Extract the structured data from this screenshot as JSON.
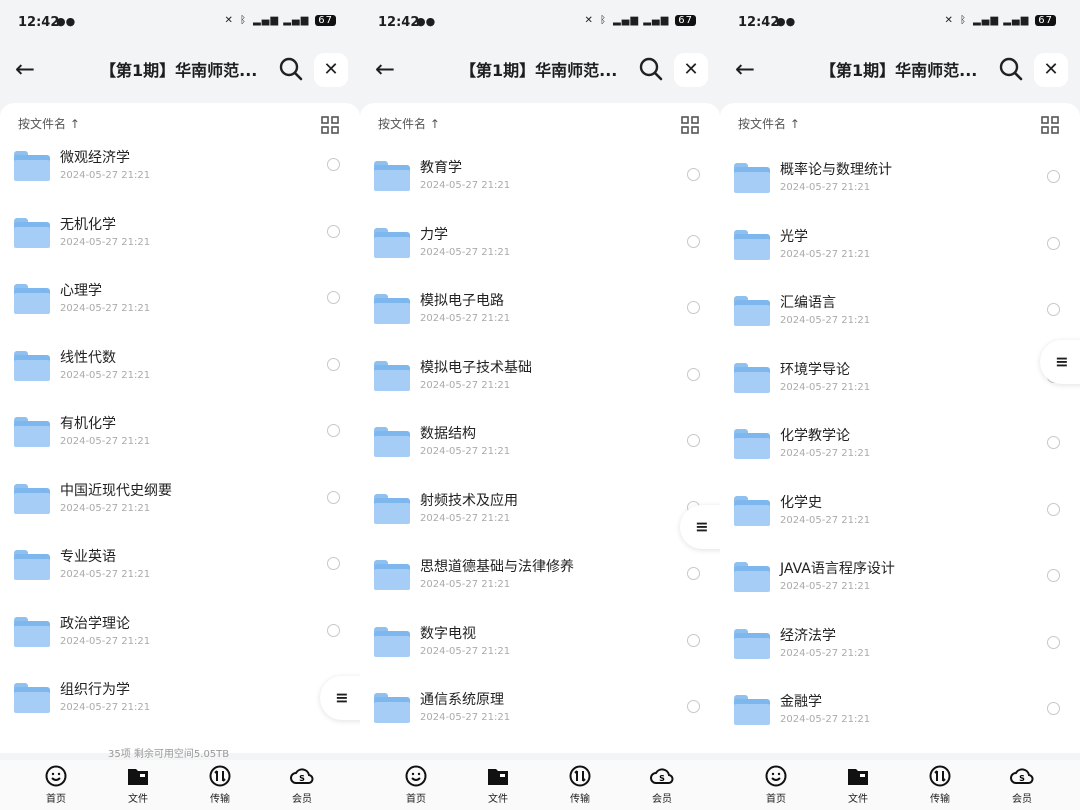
{
  "status": {
    "time": "12:42",
    "battery": "67"
  },
  "header": {
    "title": "【第1期】华南师范..."
  },
  "sort_label": "按文件名 ↑",
  "footer_info": "35项 剩余可用空间5.05TB",
  "tabs": [
    "首页",
    "文件",
    "传输",
    "会员"
  ],
  "screens": [
    {
      "files": [
        {
          "name": "微观经济学",
          "date": "2024-05-27 21:21"
        },
        {
          "name": "无机化学",
          "date": "2024-05-27 21:21"
        },
        {
          "name": "心理学",
          "date": "2024-05-27 21:21"
        },
        {
          "name": "线性代数",
          "date": "2024-05-27 21:21"
        },
        {
          "name": "有机化学",
          "date": "2024-05-27 21:21"
        },
        {
          "name": "中国近现代史纲要",
          "date": "2024-05-27 21:21"
        },
        {
          "name": "专业英语",
          "date": "2024-05-27 21:21"
        },
        {
          "name": "政治学理论",
          "date": "2024-05-27 21:21"
        },
        {
          "name": "组织行为学",
          "date": "2024-05-27 21:21"
        }
      ]
    },
    {
      "files": [
        {
          "name": "教育学",
          "date": "2024-05-27 21:21"
        },
        {
          "name": "力学",
          "date": "2024-05-27 21:21"
        },
        {
          "name": "模拟电子电路",
          "date": "2024-05-27 21:21"
        },
        {
          "name": "模拟电子技术基础",
          "date": "2024-05-27 21:21"
        },
        {
          "name": "数据结构",
          "date": "2024-05-27 21:21"
        },
        {
          "name": "射频技术及应用",
          "date": "2024-05-27 21:21"
        },
        {
          "name": "思想道德基础与法律修养",
          "date": "2024-05-27 21:21"
        },
        {
          "name": "数字电视",
          "date": "2024-05-27 21:21"
        },
        {
          "name": "通信系统原理",
          "date": "2024-05-27 21:21"
        }
      ]
    },
    {
      "files": [
        {
          "name": "概率论与数理统计",
          "date": "2024-05-27 21:21"
        },
        {
          "name": "光学",
          "date": "2024-05-27 21:21"
        },
        {
          "name": "汇编语言",
          "date": "2024-05-27 21:21"
        },
        {
          "name": "环境学导论",
          "date": "2024-05-27 21:21"
        },
        {
          "name": "化学教学论",
          "date": "2024-05-27 21:21"
        },
        {
          "name": "化学史",
          "date": "2024-05-27 21:21"
        },
        {
          "name": "JAVA语言程序设计",
          "date": "2024-05-27 21:21"
        },
        {
          "name": "经济法学",
          "date": "2024-05-27 21:21"
        },
        {
          "name": "金融学",
          "date": "2024-05-27 21:21"
        }
      ]
    }
  ]
}
